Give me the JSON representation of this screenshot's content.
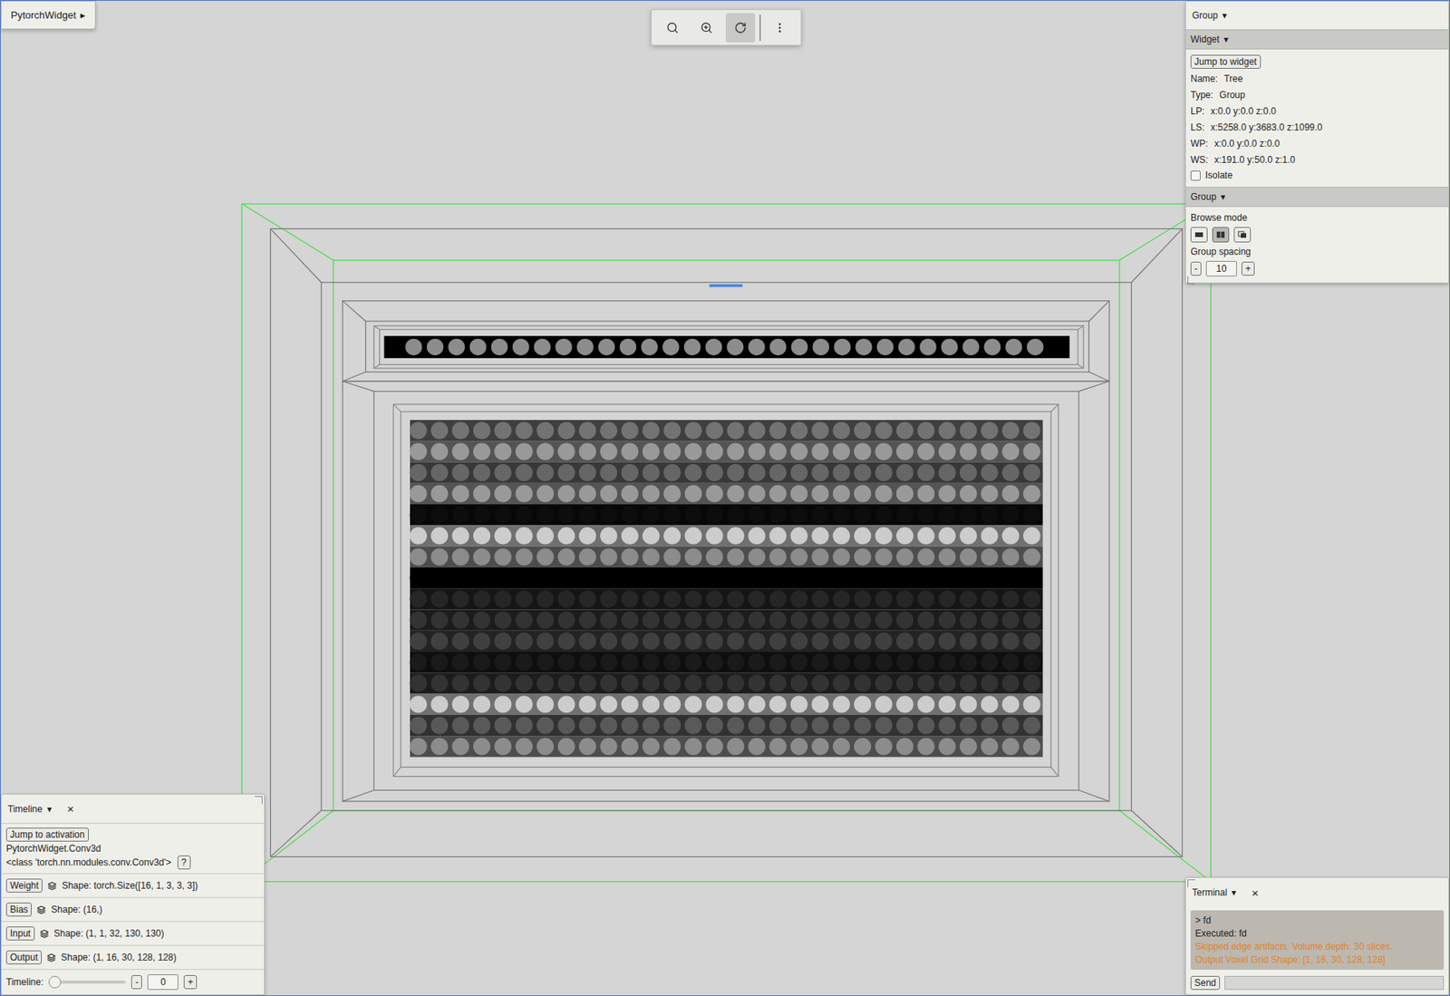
{
  "app_menu": {
    "label": "PytorchWidget",
    "arrow": "▸"
  },
  "toolbar": {
    "tools": [
      {
        "kind": "search",
        "selected": false
      },
      {
        "kind": "zoom",
        "selected": false
      },
      {
        "kind": "rotate",
        "selected": true
      },
      {
        "kind": "more",
        "selected": false
      }
    ]
  },
  "inspector": {
    "title": "Group",
    "arrow": "▾",
    "widget_section": {
      "title": "Widget",
      "button": "Jump to widget",
      "fields": [
        {
          "label": "Name:",
          "value": "Tree"
        },
        {
          "label": "Type:",
          "value": "Group"
        },
        {
          "label": "LP:",
          "value": "x:0.0 y:0.0 z:0.0"
        },
        {
          "label": "LS:",
          "value": "x:5258.0 y:3683.0 z:1099.0"
        },
        {
          "label": "WP:",
          "value": "x:0.0 y:0.0 z:0.0"
        },
        {
          "label": "WS:",
          "value": "x:191.0 y:50.0 z:1.0"
        }
      ],
      "isolate": {
        "label": "Isolate",
        "checked": false
      }
    },
    "group_section": {
      "title": "Group",
      "browse_label": "Browse mode",
      "browse_modes": [
        {
          "kind": "stack",
          "selected": false
        },
        {
          "kind": "split",
          "selected": true
        },
        {
          "kind": "overlap",
          "selected": false
        }
      ],
      "spacing_label": "Group spacing",
      "spacing_value": "10",
      "minus": "-",
      "plus": "+"
    }
  },
  "timeline": {
    "title": "Timeline",
    "arrow": "▾",
    "close": "×",
    "button": "Jump to activation",
    "module": "PytorchWidget.Conv3d",
    "class_name": "<class 'torch.nn.modules.conv.Conv3d'>",
    "help": "?",
    "tensors": [
      {
        "label": "Weight",
        "shape": "Shape: torch.Size([16, 1, 3, 3, 3])"
      },
      {
        "label": "Bias",
        "shape": "Shape: (16,)"
      },
      {
        "label": "Input",
        "shape": "Shape: (1, 1, 32, 130, 130)"
      },
      {
        "label": "Output",
        "shape": "Shape: (1, 16, 30, 128, 128)"
      }
    ],
    "slider": {
      "label": "Timeline:",
      "level": 0,
      "value": "0",
      "minus": "-",
      "plus": "+"
    }
  },
  "terminal": {
    "title": "Terminal",
    "arrow": "▾",
    "close": "×",
    "lines": [
      {
        "text": "> fd",
        "kind": "echo"
      },
      {
        "text": "Executed: fd",
        "kind": "echo"
      },
      {
        "text": "Skipped edge artifacts. Volume depth: 30 slices.",
        "kind": "warning"
      },
      {
        "text": "Output Voxel Grid Shape: [1, 16, 30, 128, 128]",
        "kind": "warning"
      }
    ],
    "send": "Send",
    "input": ""
  },
  "canvas": {
    "input_strip": {
      "level": 0.55
    },
    "output_rows": [
      {
        "level": 0.45
      },
      {
        "level": 0.6
      },
      {
        "level": 0.4
      },
      {
        "level": 0.6
      },
      {
        "level": 0.05
      },
      {
        "level": 0.8
      },
      {
        "level": 0.55
      },
      {
        "level": 0
      },
      {
        "level": 0.15
      },
      {
        "level": 0.2
      },
      {
        "level": 0.25
      },
      {
        "level": 0.1
      },
      {
        "level": 0.2
      },
      {
        "level": 0.8
      },
      {
        "level": 0.35
      },
      {
        "level": 0.55
      }
    ]
  }
}
